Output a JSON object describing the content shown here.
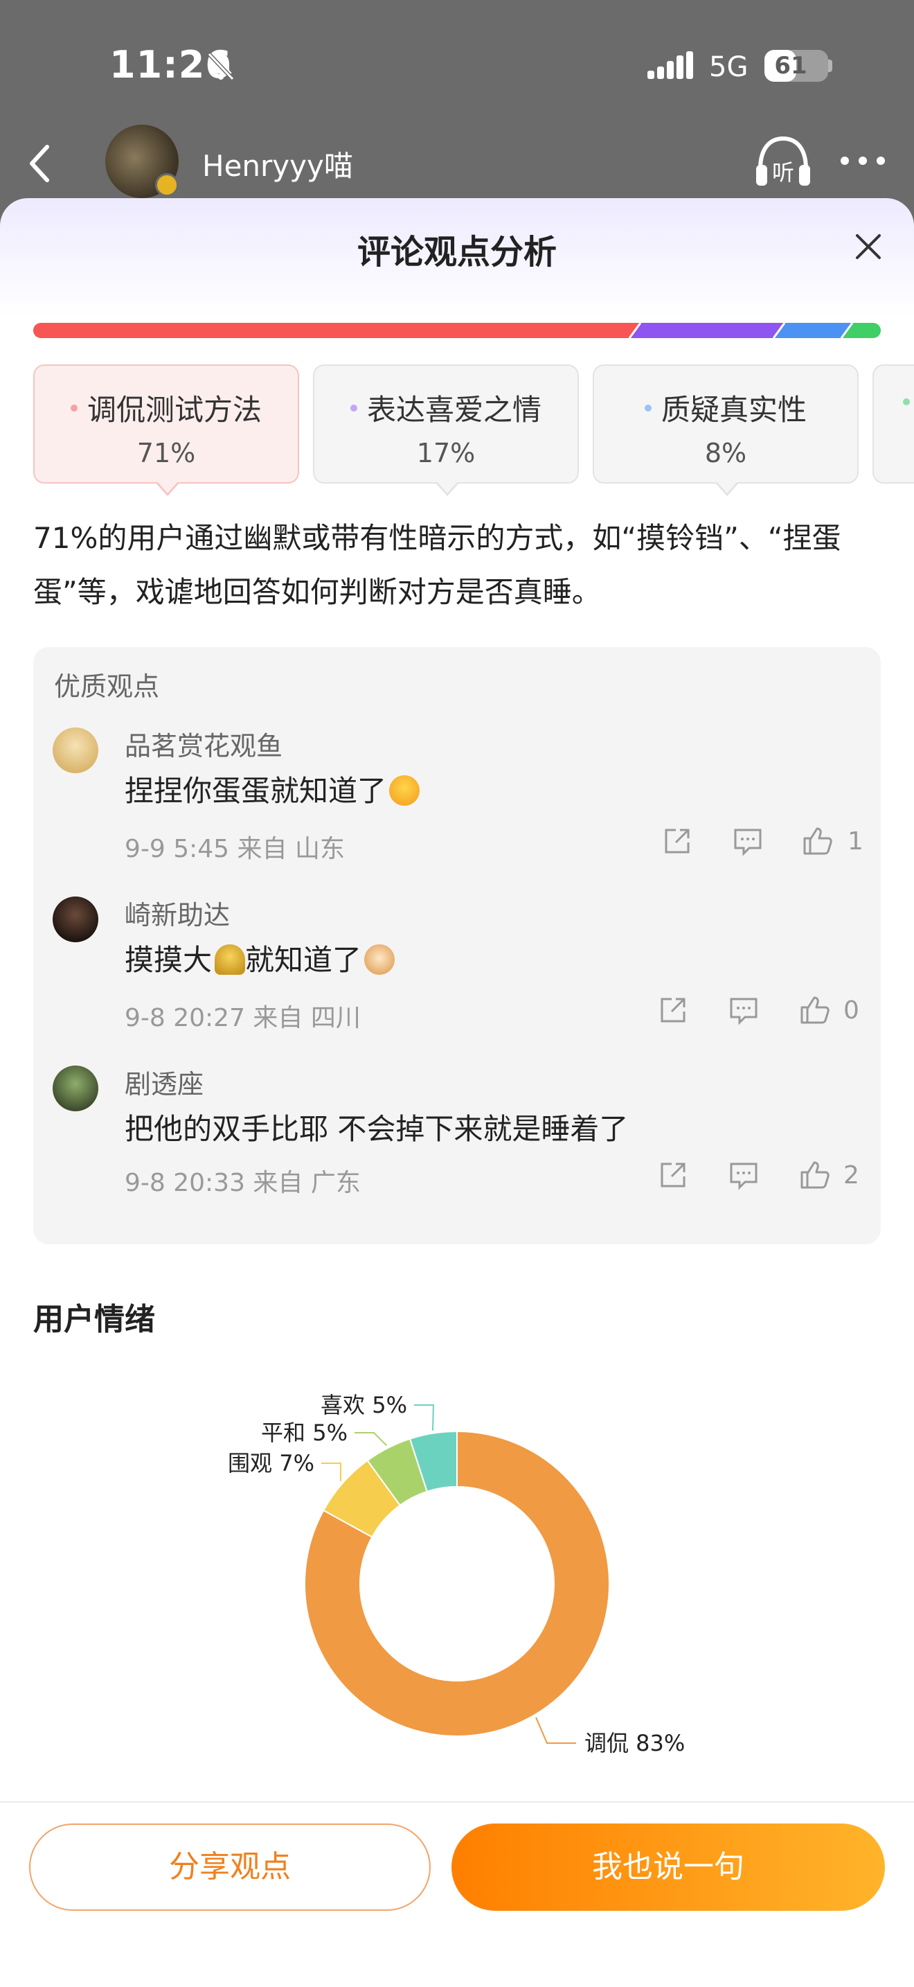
{
  "status_bar": {
    "time": "11:26",
    "network": "5G",
    "battery": "61",
    "battery_level": 0.61
  },
  "header": {
    "username": "Henryyy喵",
    "listen_label": "听"
  },
  "sheet": {
    "title": "评论观点分析",
    "distribution": [
      {
        "name": "调侃测试方法",
        "percent": 71,
        "color": "#f85555"
      },
      {
        "name": "表达喜爱之情",
        "percent": 17,
        "color": "#8f55f0"
      },
      {
        "name": "质疑真实性",
        "percent": 8,
        "color": "#4c92f2"
      },
      {
        "name": "",
        "percent": 4,
        "color": "#3fcf66"
      }
    ],
    "tabs": [
      {
        "label": "调侃测试方法",
        "percent": "71%",
        "dot_color": "#f8a0a0"
      },
      {
        "label": "表达喜爱之情",
        "percent": "17%",
        "dot_color": "#c6a5f5"
      },
      {
        "label": "质疑真实性",
        "percent": "8%",
        "dot_color": "#9cc2f6"
      }
    ],
    "summary": "71%的用户通过幽默或带有性暗示的方式，如“摸铃铛”、“捏蛋蛋”等，戏谑地回答如何判断对方是否真睡。",
    "quality": {
      "title": "优质观点",
      "comments": [
        {
          "name": "品茗赏花观鱼",
          "text": "捏捏你蛋蛋就知道了",
          "meta": "9-9 5:45 来自 山东",
          "likes": "1"
        },
        {
          "name": "崎新助达",
          "text_a": "摸摸大",
          "text_b": "就知道了",
          "meta": "9-8 20:27 来自 四川",
          "likes": "0"
        },
        {
          "name": "剧透座",
          "text": "把他的双手比耶 不会掉下来就是睡着了",
          "meta": "9-8 20:33 来自 广东",
          "likes": "2"
        }
      ]
    },
    "emotion_title": "用户情绪"
  },
  "chart_data": {
    "type": "pie",
    "title": "",
    "donut": true,
    "slices": [
      {
        "label": "调侃",
        "value": 83,
        "display": "调侃 83%",
        "color": "#f09a43"
      },
      {
        "label": "围观",
        "value": 7,
        "display": "围观 7%",
        "color": "#f6cd4c"
      },
      {
        "label": "平和",
        "value": 5,
        "display": "平和 5%",
        "color": "#a9d36a"
      },
      {
        "label": "喜欢",
        "value": 5,
        "display": "喜欢 5%",
        "color": "#6cd2c0"
      }
    ]
  },
  "footer": {
    "share_label": "分享观点",
    "say_label": "我也说一句"
  }
}
